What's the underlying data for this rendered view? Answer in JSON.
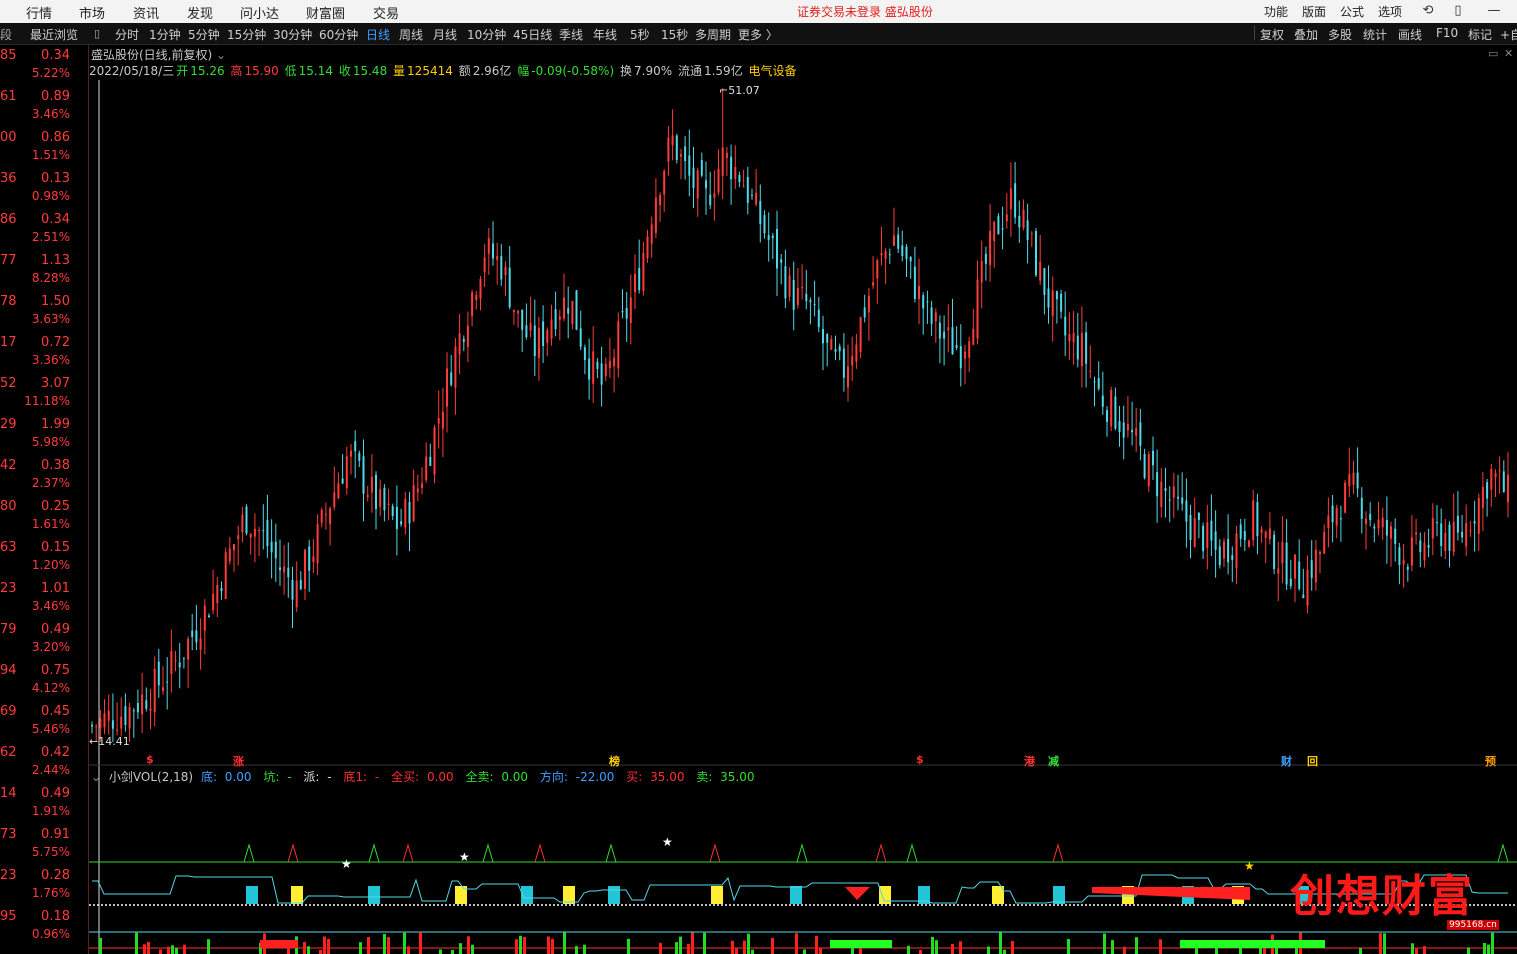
{
  "menu": [
    "行情",
    "市场",
    "资讯",
    "发现",
    "问小达",
    "财富圈",
    "交易"
  ],
  "notice": "证券交易未登录  盛弘股份",
  "right_menu": [
    "功能",
    "版面",
    "公式",
    "选项"
  ],
  "periods": [
    "最近浏览",
    "分时",
    "1分钟",
    "5分钟",
    "15分钟",
    "30分钟",
    "60分钟",
    "日线",
    "周线",
    "月线",
    "10分钟",
    "45日线",
    "季线",
    "年线",
    "5秒",
    "15秒",
    "多周期",
    "更多 〉"
  ],
  "active_period": "日线",
  "tools": [
    "复权",
    "叠加",
    "多股",
    "统计",
    "画线",
    "F10",
    "标记",
    "+自"
  ],
  "left_partial": "段",
  "left_rows": [
    {
      "a": "85",
      "b": "0.34",
      "c": "5.22%"
    },
    {
      "a": "61",
      "b": "0.89",
      "c": "3.46%"
    },
    {
      "a": "00",
      "b": "0.86",
      "c": "1.51%"
    },
    {
      "a": "36",
      "b": "0.13",
      "c": "0.98%"
    },
    {
      "a": "86",
      "b": "0.34",
      "c": "2.51%"
    },
    {
      "a": "77",
      "b": "1.13",
      "c": "8.28%"
    },
    {
      "a": "78",
      "b": "1.50",
      "c": "3.63%"
    },
    {
      "a": "17",
      "b": "0.72",
      "c": "3.36%"
    },
    {
      "a": "52",
      "b": "3.07",
      "c": "11.18%"
    },
    {
      "a": "29",
      "b": "1.99",
      "c": "5.98%"
    },
    {
      "a": "42",
      "b": "0.38",
      "c": "2.37%"
    },
    {
      "a": "80",
      "b": "0.25",
      "c": "1.61%"
    },
    {
      "a": "63",
      "b": "0.15",
      "c": "1.20%"
    },
    {
      "a": "23",
      "b": "1.01",
      "c": "3.46%"
    },
    {
      "a": "79",
      "b": "0.49",
      "c": "3.20%"
    },
    {
      "a": "94",
      "b": "0.75",
      "c": "4.12%"
    },
    {
      "a": "69",
      "b": "0.45",
      "c": "5.46%"
    },
    {
      "a": "62",
      "b": "0.42",
      "c": "2.44%"
    },
    {
      "a": "14",
      "b": "0.49",
      "c": "1.91%"
    },
    {
      "a": "73",
      "b": "0.91",
      "c": "5.75%"
    },
    {
      "a": "23",
      "b": "0.28",
      "c": "1.76%"
    },
    {
      "a": "95",
      "b": "0.18",
      "c": "0.96%"
    }
  ],
  "chart_title": "盛弘股份(日线,前复权)",
  "info": {
    "date": "2022/05/18/三",
    "open_label": "开",
    "open": "15.26",
    "high_label": "高",
    "high": "15.90",
    "low_label": "低",
    "low": "15.14",
    "close_label": "收",
    "close": "15.48",
    "vol_label": "量",
    "vol": "125414",
    "amt_label": "额",
    "amt": "2.96亿",
    "chg_label": "幅",
    "chg": "-0.09(-0.58%)",
    "turn_label": "换",
    "turn": "7.90%",
    "float_label": "流通",
    "float": "1.59亿",
    "sector": "电气设备"
  },
  "price_labels": {
    "high": "51.07",
    "low": "14.41"
  },
  "markers": [
    {
      "t": "$",
      "c": "#ff3030"
    },
    {
      "t": "涨",
      "c": "#ff3030"
    },
    {
      "t": "榜",
      "c": "#ffcc00"
    },
    {
      "t": "$",
      "c": "#ff3030"
    },
    {
      "t": "港",
      "c": "#ff3030"
    },
    {
      "t": "减",
      "c": "#33dd33"
    },
    {
      "t": "财",
      "c": "#3ea0ff"
    },
    {
      "t": "回",
      "c": "#ffcc00"
    },
    {
      "t": "预",
      "c": "#ff9900"
    }
  ],
  "indicator": {
    "name": "小剑VOL(2,18)",
    "items": [
      {
        "l": "底: ",
        "v": "0.00",
        "c": "#3ea0ff"
      },
      {
        "l": "坑: ",
        "v": "-",
        "c": "#33dd33"
      },
      {
        "l": "派: ",
        "v": "-",
        "c": "#dddddd"
      },
      {
        "l": "底1: ",
        "v": "-",
        "c": "#ff3030"
      },
      {
        "l": "全买: ",
        "v": "0.00",
        "c": "#ff3030"
      },
      {
        "l": "全卖: ",
        "v": "0.00",
        "c": "#33dd33"
      },
      {
        "l": "方向: ",
        "v": "-22.00",
        "c": "#3ea0ff"
      },
      {
        "l": "买: ",
        "v": "35.00",
        "c": "#ff3030"
      },
      {
        "l": "卖: ",
        "v": "35.00",
        "c": "#33dd33"
      }
    ]
  },
  "watermark": "创想财富",
  "watermark_url": "995168.cn",
  "colors": {
    "up": "#ff3b3b",
    "down": "#4fd9e8",
    "bg": "#000000",
    "accent": "#3ea0ff"
  },
  "chart_data": {
    "type": "candlestick",
    "title": "盛弘股份(日线,前复权)",
    "high_mark": 51.07,
    "low_mark": 14.41,
    "close_path": [
      15.3,
      15.8,
      16.1,
      16.9,
      17.8,
      19.0,
      20.6,
      22.4,
      24.8,
      27.1,
      26.0,
      24.2,
      23.1,
      25.3,
      28.0,
      30.5,
      29.0,
      27.4,
      26.5,
      28.4,
      31.5,
      35.3,
      38.6,
      42.0,
      41.2,
      38.0,
      36.4,
      38.5,
      39.3,
      36.0,
      34.2,
      37.5,
      40.4,
      45.1,
      48.2,
      46.0,
      44.8,
      47.3,
      46.2,
      44.0,
      41.8,
      39.5,
      38.9,
      36.4,
      35.1,
      37.8,
      40.9,
      42.8,
      40.6,
      38.2,
      37.0,
      36.4,
      39.8,
      43.2,
      45.0,
      42.3,
      39.4,
      37.2,
      36.5,
      34.0,
      32.8,
      31.4,
      29.6,
      28.2,
      27.0,
      26.1,
      24.9,
      25.8,
      27.0,
      25.4,
      24.3,
      23.5,
      25.1,
      27.8,
      28.6,
      26.9,
      26.0,
      24.8,
      25.3,
      26.3,
      25.6,
      27.4,
      29.5,
      28.3
    ]
  }
}
